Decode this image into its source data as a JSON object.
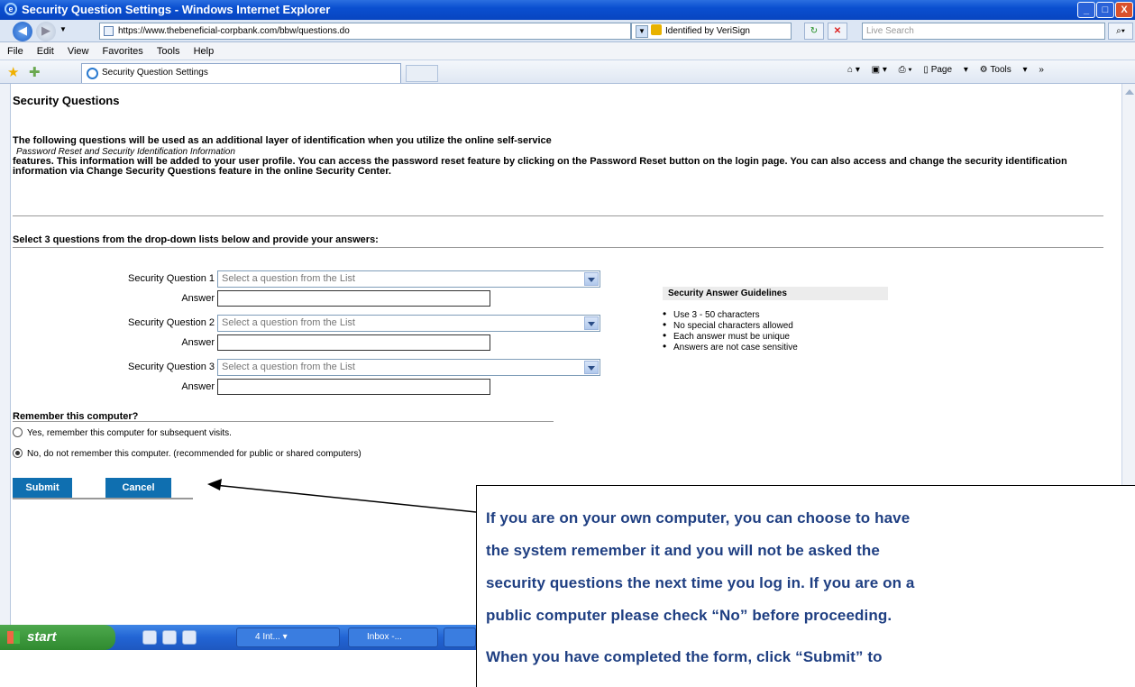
{
  "window": {
    "title": "Security Question Settings - Windows Internet Explorer",
    "min": "_",
    "max": "□",
    "close": "X"
  },
  "address": {
    "url": "https://www.thebeneficial-corpbank.com/bbw/questions.do",
    "identity": "Identified by VeriSign",
    "search_placeholder": "Live Search"
  },
  "menu": {
    "items": [
      "File",
      "Edit",
      "View",
      "Favorites",
      "Tools",
      "Help"
    ]
  },
  "tab": {
    "title": "Security Question Settings"
  },
  "commands": {
    "page": "Page",
    "tools": "Tools"
  },
  "page": {
    "heading": "Security Questions",
    "intro_line1": "The following questions will be used as an additional layer of identification when you utilize the online self-service",
    "intro_line2": "Password Reset and Security Identification Information",
    "intro_line3": "features. This information will be added to your user profile. You can access the password reset feature by clicking on the Password Reset button on the login page. You can also access and change the security identification information via Change Security Questions feature in the online Security Center.",
    "select_instruction": "Select 3 questions from the drop-down lists below and provide your answers:",
    "questions": [
      {
        "label": "Security Question 1",
        "placeholder": "Select a question from the List",
        "answer_label": "Answer",
        "answer": ""
      },
      {
        "label": "Security Question 2",
        "placeholder": "Select a question from the List",
        "answer_label": "Answer",
        "answer": ""
      },
      {
        "label": "Security Question 3",
        "placeholder": "Select a question from the List",
        "answer_label": "Answer",
        "answer": ""
      }
    ],
    "guidelines": {
      "title": "Security Answer Guidelines",
      "items": [
        "Use 3 - 50 characters",
        "No special characters allowed",
        "Each answer must be unique",
        "Answers are not case sensitive"
      ]
    },
    "remember": {
      "title": "Remember this computer?",
      "yes": "Yes, remember this computer for subsequent visits.",
      "no": "No, do not remember this computer. (recommended for public or shared computers)",
      "selected": "no"
    },
    "submit": "Submit",
    "cancel": "Cancel"
  },
  "taskbar": {
    "start": "start",
    "buttons": [
      "4 Int...",
      "Inbox -..."
    ]
  },
  "callout": {
    "lines": [
      "If you are on your own computer, you can choose to have",
      "the system remember it and you will not be asked the",
      "security questions the next time you log in. If you are on a",
      "public computer please check “No” before proceeding.",
      "When you have completed the form, click “Submit” to"
    ],
    "color": "#1f3f82"
  }
}
